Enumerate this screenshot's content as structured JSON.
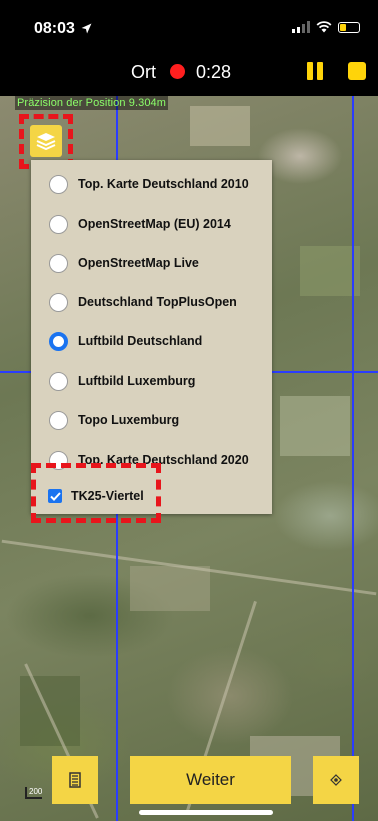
{
  "status_bar": {
    "time": "08:03"
  },
  "recording": {
    "location_label": "Ort",
    "elapsed": "0:28",
    "record_color": "#ff1f1f",
    "accent_color": "#ffd40a"
  },
  "map": {
    "precision_text": "Präzision der Position 9.304m",
    "grid_color": "#2a3cff",
    "scale_text": "200"
  },
  "layers_menu": {
    "options": [
      {
        "label": "Top. Karte Deutschland 2010",
        "selected": false
      },
      {
        "label": "OpenStreetMap (EU) 2014",
        "selected": false
      },
      {
        "label": "OpenStreetMap Live",
        "selected": false
      },
      {
        "label": "Deutschland TopPlusOpen",
        "selected": false
      },
      {
        "label": "Luftbild Deutschland",
        "selected": true
      },
      {
        "label": "Luftbild Luxemburg",
        "selected": false
      },
      {
        "label": "Topo Luxemburg",
        "selected": false
      },
      {
        "label": "Top. Karte Deutschland 2020",
        "selected": false
      }
    ],
    "overlay": {
      "label": "TK25-Viertel",
      "checked": true
    },
    "selected_color": "#1a73f0"
  },
  "bottom_bar": {
    "continue_label": "Weiter",
    "button_color": "#f4d545"
  },
  "highlight_color": "#e8151c"
}
